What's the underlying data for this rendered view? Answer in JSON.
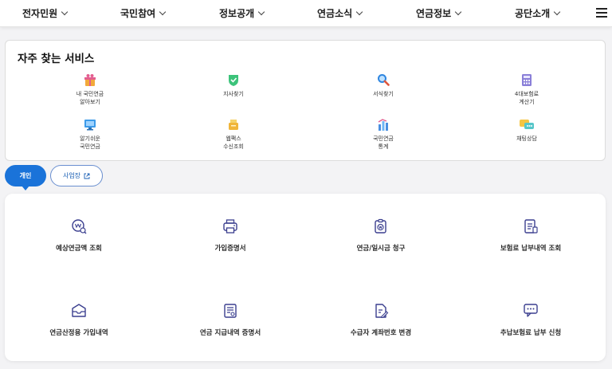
{
  "nav": {
    "items": [
      {
        "label": "전자민원"
      },
      {
        "label": "국민참여"
      },
      {
        "label": "정보공개"
      },
      {
        "label": "연금소식"
      },
      {
        "label": "연금정보"
      },
      {
        "label": "공단소개"
      }
    ]
  },
  "favorites": {
    "title": "자주 찾는 서비스",
    "items": [
      {
        "label": "내 국민연금\n알아보기",
        "icon": "gift-icon"
      },
      {
        "label": "지사찾기",
        "icon": "shield-map-icon"
      },
      {
        "label": "서식찾기",
        "icon": "magnifier-icon"
      },
      {
        "label": "4대보험료\n계산기",
        "icon": "calculator-icon"
      },
      {
        "label": "알기쉬운\n국민연금",
        "icon": "monitor-icon"
      },
      {
        "label": "웹팩스\n수신조회",
        "icon": "fax-icon"
      },
      {
        "label": "국민연금\n통계",
        "icon": "statistics-icon"
      },
      {
        "label": "채팅상담",
        "icon": "chat-icon"
      }
    ]
  },
  "tabs": {
    "personal": "개인",
    "business": "사업장"
  },
  "services": {
    "items": [
      {
        "label": "예상연금액 조회",
        "icon": "pension-search-icon"
      },
      {
        "label": "가입증명서",
        "icon": "printer-icon"
      },
      {
        "label": "연금/일시금 청구",
        "icon": "clipboard-won-icon"
      },
      {
        "label": "보험료 납부내역 조회",
        "icon": "document-list-icon"
      },
      {
        "label": "연금산정용 가입내역",
        "icon": "envelope-icon"
      },
      {
        "label": "연금 지급내역 증명서",
        "icon": "certificate-icon"
      },
      {
        "label": "수급자 계좌번호 변경",
        "icon": "document-edit-icon"
      },
      {
        "label": "추납보험료 납부 신청",
        "icon": "chat-bubble-icon"
      }
    ]
  },
  "colors": {
    "accent": "#1a73d9",
    "icon_stroke": "#3b3f8f"
  }
}
